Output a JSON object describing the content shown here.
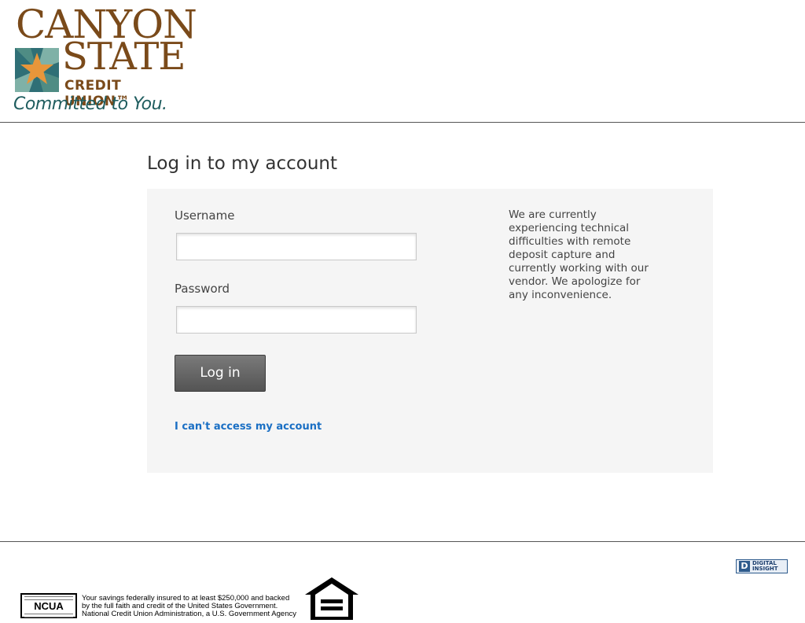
{
  "brand": {
    "name_line1": "CANYON",
    "name_line2": "STATE",
    "name_line3": "CREDIT UNION™",
    "tagline": "Committed to You."
  },
  "login": {
    "title": "Log in to my account",
    "username_label": "Username",
    "username_value": "",
    "password_label": "Password",
    "password_value": "",
    "submit_label": "Log in",
    "help_link": "I can't access my account"
  },
  "notice": {
    "text": "We are currently experiencing technical difficulties with remote deposit capture and currently working with our vendor.  We apologize for any inconvenience."
  },
  "footer": {
    "vendor_logo_line1": "DIGITAL",
    "vendor_logo_line2": "INSIGHT",
    "ncua_label": "NCUA",
    "ncua_line1": "Your savings federally insured to at least $250,000 and backed",
    "ncua_line2": "by the full faith and credit of the United States Government.",
    "ncua_line3": "National Credit Union Administration, a U.S. Government Agency"
  },
  "colors": {
    "brand_brown": "#7a4a1a",
    "brand_teal": "#1f5d5f",
    "star_orange": "#e8963a",
    "link_blue": "#1a6fc4",
    "button_gray": "#5e5e5e",
    "panel_bg": "#f5f5f5"
  }
}
